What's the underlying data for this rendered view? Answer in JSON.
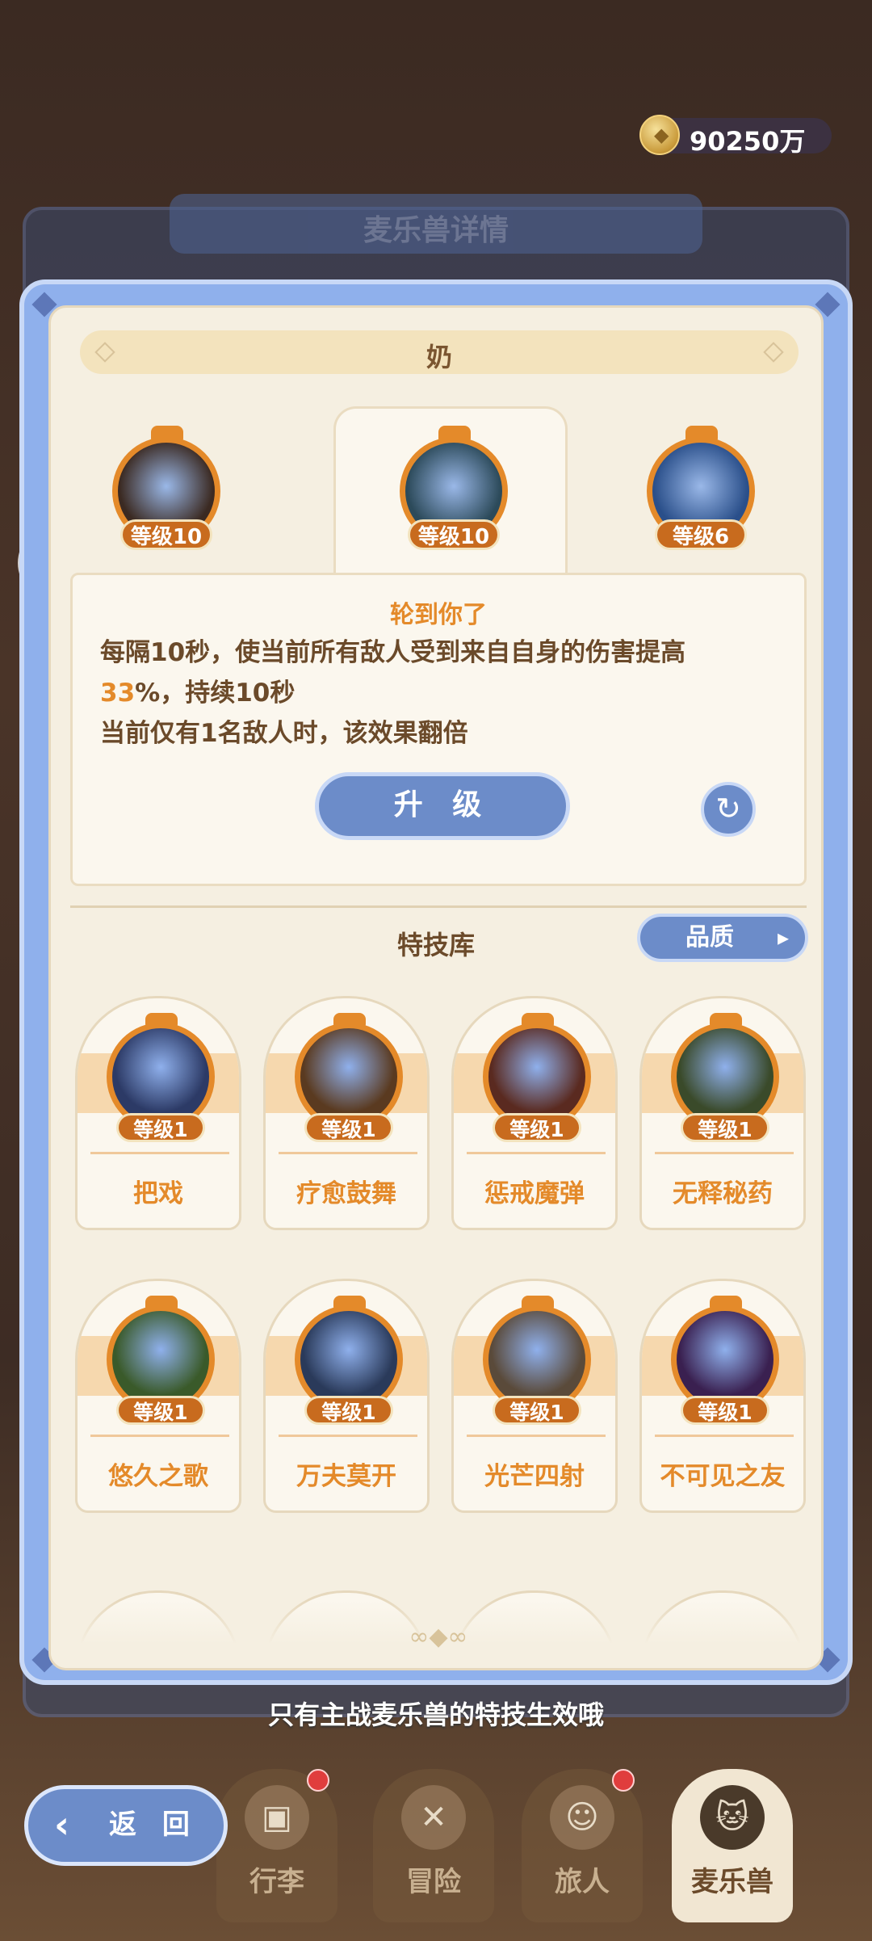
{
  "currency": {
    "amount": "90250万",
    "icon": "coin-icon"
  },
  "back_panel": {
    "title": "麦乐兽详情"
  },
  "panel": {
    "header": "奶",
    "slots": [
      {
        "level": "等级10",
        "color": "#3b2a22"
      },
      {
        "level": "等级10",
        "color": "#2c4a5a"
      },
      {
        "level": "等级6",
        "color": "#2a4f8a"
      }
    ],
    "description": {
      "title": "轮到你了",
      "line1": "每隔10秒，使当前所有敌人受到来自自身的伤害提高",
      "line2_highlight": "33",
      "line2_rest": "%，持续10秒",
      "line3": "当前仅有1名敌人时，该效果翻倍"
    },
    "upgrade_label": "升 级",
    "refresh_icon": "refresh-icon",
    "library_title": "特技库",
    "quality_label": "品质",
    "skills": [
      {
        "name": "把戏",
        "level": "等级1",
        "color": "#2c3a66"
      },
      {
        "name": "疗愈鼓舞",
        "level": "等级1",
        "color": "#5a3a20"
      },
      {
        "name": "惩戒魔弹",
        "level": "等级1",
        "color": "#5a2a20"
      },
      {
        "name": "无释秘药",
        "level": "等级1",
        "color": "#3a4a2a"
      },
      {
        "name": "悠久之歌",
        "level": "等级1",
        "color": "#3a5a2a"
      },
      {
        "name": "万夫莫开",
        "level": "等级1",
        "color": "#2a3a5a"
      },
      {
        "name": "光芒四射",
        "level": "等级1",
        "color": "#5a4a3a"
      },
      {
        "name": "不可见之友",
        "level": "等级1",
        "color": "#3a2050"
      }
    ]
  },
  "hint": "只有主战麦乐兽的特技生效哦",
  "nav": {
    "back_label": "返 回",
    "items": [
      {
        "label": "行李",
        "badge": true
      },
      {
        "label": "冒险",
        "badge": false
      },
      {
        "label": "旅人",
        "badge": true
      },
      {
        "label": "麦乐兽",
        "badge": false
      }
    ]
  },
  "colors": {
    "accent": "#e48a2a",
    "button": "#6c8cc9",
    "panel": "#f5efe1"
  }
}
